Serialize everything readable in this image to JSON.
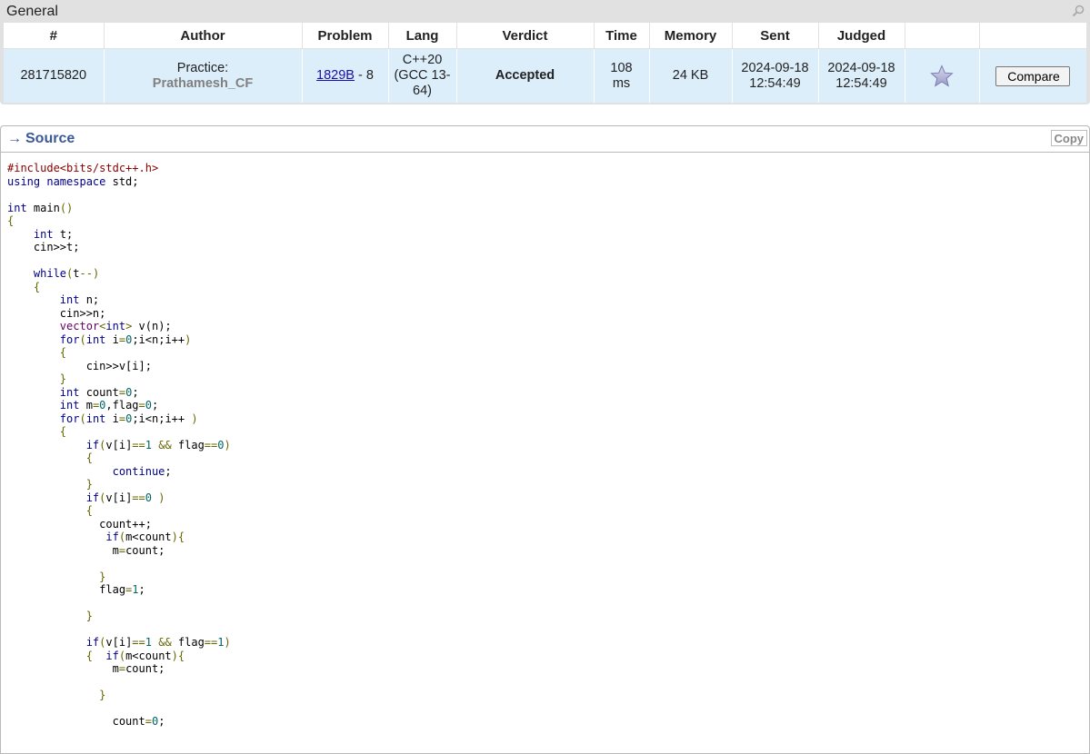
{
  "general": {
    "title": "General",
    "columns": [
      "#",
      "Author",
      "Problem",
      "Lang",
      "Verdict",
      "Time",
      "Memory",
      "Sent",
      "Judged",
      "",
      ""
    ],
    "row": {
      "id": "281715820",
      "author_prefix": "Practice:",
      "author_handle": "Prathamesh_CF",
      "problem_code": "1829B",
      "problem_suffix": " - 8",
      "lang": "C++20 (GCC 13-64)",
      "verdict": "Accepted",
      "time": "108 ms",
      "memory": "24 KB",
      "sent": "2024-09-18 12:54:49",
      "judged": "2024-09-18 12:54:49",
      "compare_label": "Compare"
    }
  },
  "source": {
    "title": "Source",
    "copy_label": "Copy",
    "code_lines": [
      [
        [
          "com",
          "#include<bits/stdc++.h>"
        ]
      ],
      [
        [
          "kwd",
          "using namespace"
        ],
        [
          "pln",
          " std;"
        ]
      ],
      [],
      [
        [
          "kwd",
          "int"
        ],
        [
          "pln",
          " main"
        ],
        [
          "pun",
          "()"
        ]
      ],
      [
        [
          "pun",
          "{"
        ]
      ],
      [
        [
          "pln",
          "    "
        ],
        [
          "kwd",
          "int"
        ],
        [
          "pln",
          " t;"
        ]
      ],
      [
        [
          "pln",
          "    cin>>t;"
        ]
      ],
      [],
      [
        [
          "pln",
          "    "
        ],
        [
          "kwd",
          "while"
        ],
        [
          "pun",
          "("
        ],
        [
          "pln",
          "t"
        ],
        [
          "pun",
          "--)"
        ]
      ],
      [
        [
          "pln",
          "    "
        ],
        [
          "pun",
          "{"
        ]
      ],
      [
        [
          "pln",
          "        "
        ],
        [
          "kwd",
          "int"
        ],
        [
          "pln",
          " n;"
        ]
      ],
      [
        [
          "pln",
          "        cin>>n;"
        ]
      ],
      [
        [
          "pln",
          "        "
        ],
        [
          "typ",
          "vector"
        ],
        [
          "pun",
          "<"
        ],
        [
          "kwd",
          "int"
        ],
        [
          "pun",
          ">"
        ],
        [
          "pln",
          " v(n);"
        ]
      ],
      [
        [
          "pln",
          "        "
        ],
        [
          "kwd",
          "for"
        ],
        [
          "pun",
          "("
        ],
        [
          "kwd",
          "int"
        ],
        [
          "pln",
          " i"
        ],
        [
          "pun",
          "="
        ],
        [
          "lit",
          "0"
        ],
        [
          "pln",
          ";i<n;i++"
        ],
        [
          "pun",
          ")"
        ]
      ],
      [
        [
          "pln",
          "        "
        ],
        [
          "pun",
          "{"
        ]
      ],
      [
        [
          "pln",
          "            cin>>v[i];"
        ]
      ],
      [
        [
          "pln",
          "        "
        ],
        [
          "pun",
          "}"
        ]
      ],
      [
        [
          "pln",
          "        "
        ],
        [
          "kwd",
          "int"
        ],
        [
          "pln",
          " count"
        ],
        [
          "pun",
          "="
        ],
        [
          "lit",
          "0"
        ],
        [
          "pln",
          ";"
        ]
      ],
      [
        [
          "pln",
          "        "
        ],
        [
          "kwd",
          "int"
        ],
        [
          "pln",
          " m"
        ],
        [
          "pun",
          "="
        ],
        [
          "lit",
          "0"
        ],
        [
          "pln",
          ",flag"
        ],
        [
          "pun",
          "="
        ],
        [
          "lit",
          "0"
        ],
        [
          "pln",
          ";"
        ]
      ],
      [
        [
          "pln",
          "        "
        ],
        [
          "kwd",
          "for"
        ],
        [
          "pun",
          "("
        ],
        [
          "kwd",
          "int"
        ],
        [
          "pln",
          " i"
        ],
        [
          "pun",
          "="
        ],
        [
          "lit",
          "0"
        ],
        [
          "pln",
          ";i<n;i++ "
        ],
        [
          "pun",
          ")"
        ]
      ],
      [
        [
          "pln",
          "        "
        ],
        [
          "pun",
          "{"
        ]
      ],
      [
        [
          "pln",
          "            "
        ],
        [
          "kwd",
          "if"
        ],
        [
          "pun",
          "("
        ],
        [
          "pln",
          "v[i]"
        ],
        [
          "pun",
          "=="
        ],
        [
          "lit",
          "1"
        ],
        [
          "pln",
          " "
        ],
        [
          "pun",
          "&&"
        ],
        [
          "pln",
          " flag"
        ],
        [
          "pun",
          "=="
        ],
        [
          "lit",
          "0"
        ],
        [
          "pun",
          ")"
        ]
      ],
      [
        [
          "pln",
          "            "
        ],
        [
          "pun",
          "{"
        ]
      ],
      [
        [
          "pln",
          "                "
        ],
        [
          "kwd",
          "continue"
        ],
        [
          "pln",
          ";"
        ]
      ],
      [
        [
          "pln",
          "            "
        ],
        [
          "pun",
          "}"
        ]
      ],
      [
        [
          "pln",
          "            "
        ],
        [
          "kwd",
          "if"
        ],
        [
          "pun",
          "("
        ],
        [
          "pln",
          "v[i]"
        ],
        [
          "pun",
          "=="
        ],
        [
          "lit",
          "0"
        ],
        [
          "pln",
          " "
        ],
        [
          "pun",
          ")"
        ]
      ],
      [
        [
          "pln",
          "            "
        ],
        [
          "pun",
          "{"
        ]
      ],
      [
        [
          "pln",
          "              count++;"
        ]
      ],
      [
        [
          "pln",
          "               "
        ],
        [
          "kwd",
          "if"
        ],
        [
          "pun",
          "("
        ],
        [
          "pln",
          "m<count"
        ],
        [
          "pun",
          "){"
        ]
      ],
      [
        [
          "pln",
          "                m"
        ],
        [
          "pun",
          "="
        ],
        [
          "pln",
          "count;"
        ]
      ],
      [],
      [
        [
          "pln",
          "              "
        ],
        [
          "pun",
          "}"
        ]
      ],
      [
        [
          "pln",
          "              flag"
        ],
        [
          "pun",
          "="
        ],
        [
          "lit",
          "1"
        ],
        [
          "pln",
          ";"
        ]
      ],
      [],
      [
        [
          "pln",
          "            "
        ],
        [
          "pun",
          "}"
        ]
      ],
      [],
      [
        [
          "pln",
          "            "
        ],
        [
          "kwd",
          "if"
        ],
        [
          "pun",
          "("
        ],
        [
          "pln",
          "v[i]"
        ],
        [
          "pun",
          "=="
        ],
        [
          "lit",
          "1"
        ],
        [
          "pln",
          " "
        ],
        [
          "pun",
          "&&"
        ],
        [
          "pln",
          " flag"
        ],
        [
          "pun",
          "=="
        ],
        [
          "lit",
          "1"
        ],
        [
          "pun",
          ")"
        ]
      ],
      [
        [
          "pln",
          "            "
        ],
        [
          "pun",
          "{"
        ],
        [
          "pln",
          "  "
        ],
        [
          "kwd",
          "if"
        ],
        [
          "pun",
          "("
        ],
        [
          "pln",
          "m<count"
        ],
        [
          "pun",
          "){"
        ]
      ],
      [
        [
          "pln",
          "                m"
        ],
        [
          "pun",
          "="
        ],
        [
          "pln",
          "count;"
        ]
      ],
      [],
      [
        [
          "pln",
          "              "
        ],
        [
          "pun",
          "}"
        ]
      ],
      [],
      [
        [
          "pln",
          "                count"
        ],
        [
          "pun",
          "="
        ],
        [
          "lit",
          "0"
        ],
        [
          "pln",
          ";"
        ]
      ]
    ]
  }
}
